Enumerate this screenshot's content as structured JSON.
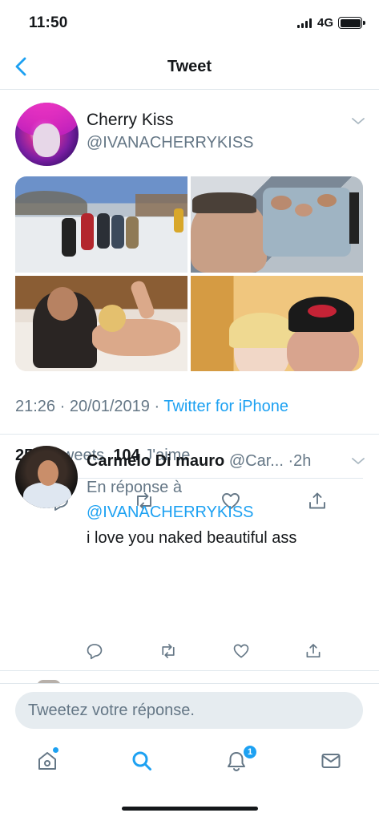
{
  "status_bar": {
    "time": "11:50",
    "network": "4G"
  },
  "nav": {
    "title": "Tweet"
  },
  "tweet": {
    "author_name": "Cherry Kiss",
    "author_handle": "@IVANACHERRYKISS",
    "timestamp": "21:26 · 20/01/2019 · ",
    "source": "Twitter for iPhone",
    "retweets_count": "25",
    "retweets_label": "Retweets",
    "likes_count": "104",
    "likes_label": "J'aime"
  },
  "reply": {
    "name": "Carmelo Di mauro",
    "handle": "@Car...",
    "time": "·2h",
    "reply_to_label": "En réponse à",
    "mention": "@IVANACHERRYKISS",
    "text": "i love you naked beautiful ass"
  },
  "composer": {
    "placeholder": "Tweetez votre réponse."
  },
  "tab_bar": {
    "notifications_badge": "1"
  },
  "colors": {
    "accent": "#1da1f2",
    "text": "#14171a",
    "secondary": "#657786",
    "divider": "#e1e8ed"
  },
  "icons": [
    "back-chevron-icon",
    "caret-down-icon",
    "reply-icon",
    "retweet-icon",
    "like-icon",
    "share-icon",
    "home-icon",
    "search-icon",
    "notifications-icon",
    "messages-icon"
  ]
}
